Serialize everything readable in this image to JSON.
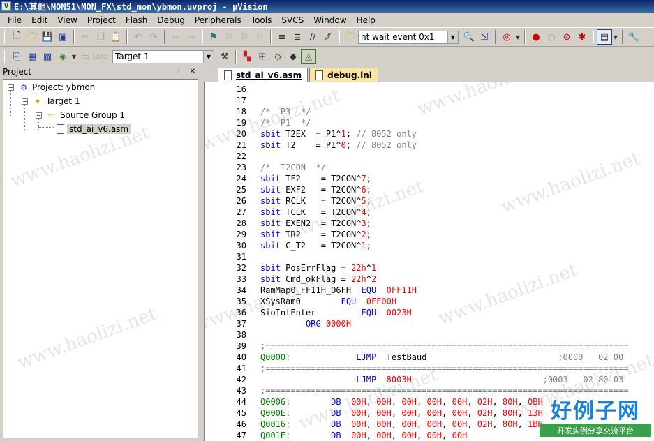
{
  "window": {
    "title": "E:\\其他\\MON51\\MON_FX\\std_mon\\ybmon.uvproj - µVision"
  },
  "menu": [
    "File",
    "Edit",
    "View",
    "Project",
    "Flash",
    "Debug",
    "Peripherals",
    "Tools",
    "SVCS",
    "Window",
    "Help"
  ],
  "toolbar": {
    "find_combo": "nt wait event 0x1",
    "target_combo": "Target 1"
  },
  "project_panel": {
    "title": "Project",
    "tree": [
      {
        "label": "Project: ybmon",
        "level": 0
      },
      {
        "label": "Target 1",
        "level": 1
      },
      {
        "label": "Source Group 1",
        "level": 2
      },
      {
        "label": "std_ai_v6.asm",
        "level": 3
      }
    ]
  },
  "tabs": [
    {
      "label": "std_ai_v6.asm",
      "active": true
    },
    {
      "label": "debug.ini",
      "active": false
    }
  ],
  "code_lines": [
    {
      "n": "16",
      "t": ""
    },
    {
      "n": "17",
      "t": ""
    },
    {
      "n": "18",
      "t": "/*  P3  */"
    },
    {
      "n": "19",
      "t": "/*  P1  */"
    },
    {
      "n": "20",
      "t": "sbit T2EX  = P1^1; // 8052 only"
    },
    {
      "n": "21",
      "t": "sbit T2    = P1^0; // 8052 only"
    },
    {
      "n": "22",
      "t": ""
    },
    {
      "n": "23",
      "t": "/*  T2CON  */"
    },
    {
      "n": "24",
      "t": "sbit TF2    = T2CON^7;"
    },
    {
      "n": "25",
      "t": "sbit EXF2   = T2CON^6;"
    },
    {
      "n": "26",
      "t": "sbit RCLK   = T2CON^5;"
    },
    {
      "n": "27",
      "t": "sbit TCLK   = T2CON^4;"
    },
    {
      "n": "28",
      "t": "sbit EXEN2  = T2CON^3;"
    },
    {
      "n": "29",
      "t": "sbit TR2    = T2CON^2;"
    },
    {
      "n": "30",
      "t": "sbit C_T2   = T2CON^1;"
    },
    {
      "n": "31",
      "t": ""
    },
    {
      "n": "32",
      "t": "sbit PosErrFlag = 22h^1"
    },
    {
      "n": "33",
      "t": "sbit Cmd_okFlag = 22h^2"
    },
    {
      "n": "34",
      "t": "RamMap0_FF11H_O6FH  EQU  0FF11H"
    },
    {
      "n": "35",
      "t": "XSysRam0        EQU  0FF00H"
    },
    {
      "n": "36",
      "t": "SioIntEnter         EQU  0023H"
    },
    {
      "n": "37",
      "t": "         ORG 0000H"
    },
    {
      "n": "38",
      "t": ""
    },
    {
      "n": "39",
      "t": ";========================================================================"
    },
    {
      "n": "40",
      "t": "Q0000:             LJMP  TestBaud                          ;0000   02 00"
    },
    {
      "n": "41",
      "t": ";========================================================================"
    },
    {
      "n": "42",
      "t": "                   LJMP  8003H                          ;0003   02 80 03"
    },
    {
      "n": "43",
      "t": ";========================================================================"
    },
    {
      "n": "44",
      "t": "Q0006:        DB  00H, 00H, 00H, 00H, 00H, 02H, 80H, 0BH"
    },
    {
      "n": "45",
      "t": "Q000E:        DB  00H, 00H, 00H, 00H, 00H, 02H, 80H, 13H"
    },
    {
      "n": "46",
      "t": "Q0016:        DB  00H, 00H, 00H, 00H, 00H, 02H, 80H, 1BH"
    },
    {
      "n": "47",
      "t": "Q001E:        DB  00H, 00H, 00H, 00H, 00H"
    }
  ],
  "watermark": {
    "site": "www.haolizi.net",
    "logo_main": "好例子网",
    "logo_sub": "开发实例分享交流平台"
  }
}
